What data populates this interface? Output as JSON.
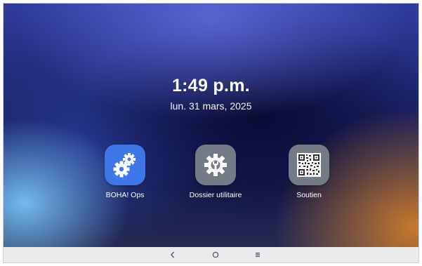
{
  "status": {
    "time": "1:49 p.m.",
    "date": "lun. 31 mars, 2025"
  },
  "apps": [
    {
      "label": "BOHA! Ops",
      "icon": "gears-icon",
      "color": "#3d76e6"
    },
    {
      "label": "Dossier utilitaire",
      "icon": "wrench-gear-icon",
      "color": "#737b87"
    },
    {
      "label": "Soutien",
      "icon": "qr-code-icon",
      "color": "#737b87"
    }
  ],
  "navbar": {
    "back_icon": "chevron-left-icon",
    "home_icon": "circle-home-icon",
    "recents_icon": "menu-lines-icon",
    "background": "#ebebee"
  }
}
